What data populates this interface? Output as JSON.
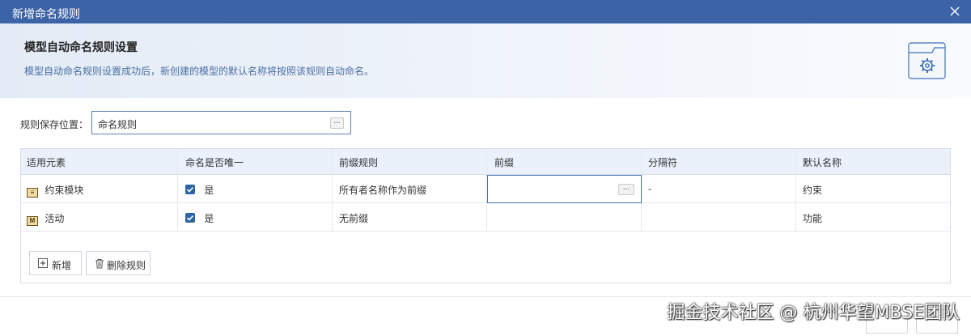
{
  "window": {
    "title": "新增命名规则"
  },
  "banner": {
    "title": "模型自动命名规则设置",
    "description": "模型自动命名规则设置成功后，新创建的模型的默认名称将按照该规则自动命名。",
    "icon": "gear-icon"
  },
  "location": {
    "label": "规则保存位置：",
    "value": "命名规则",
    "browse_label": "..."
  },
  "table": {
    "columns": [
      "适用元素",
      "命名是否唯一",
      "前缀规则",
      "前缀",
      "分隔符",
      "默认名称"
    ],
    "rows": [
      {
        "element": "约束模块",
        "element_icon": "constraint-block-icon",
        "unique_checked": true,
        "unique_label": "是",
        "prefix_rule": "所有者名称作为前缀",
        "prefix": "",
        "prefix_browse": "...",
        "separator": "-",
        "default_name": "约束"
      },
      {
        "element": "活动",
        "element_icon": "activity-icon",
        "unique_checked": true,
        "unique_label": "是",
        "prefix_rule": "无前缀",
        "prefix": "",
        "separator": "",
        "default_name": "功能"
      }
    ]
  },
  "actions": {
    "add_label": "新增",
    "delete_label": "删除规则"
  },
  "watermark": "掘金技术社区 @ 杭州华望MBSE团队",
  "colors": {
    "titlebar": "#3c63a6",
    "accent": "#2e63a8"
  }
}
